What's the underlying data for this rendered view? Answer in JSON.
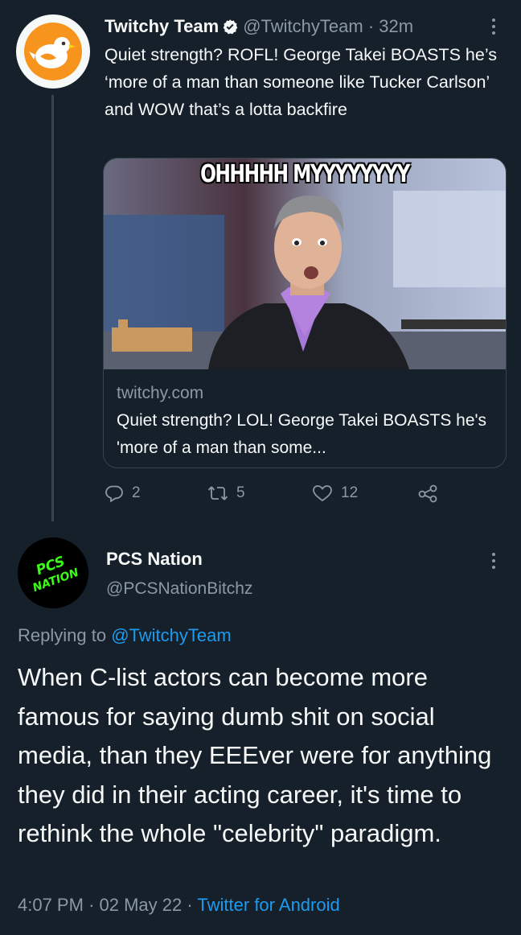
{
  "tweet1": {
    "display_name": "Twitchy Team",
    "handle": "@TwitchyTeam",
    "separator": "·",
    "time": "32m",
    "text": "Quiet strength? ROFL! George Takei BOASTS he’s ‘more of a man than someone like Tucker Carlson’ and WOW that’s a lotta backfire",
    "card": {
      "image_caption": "OHHHHH MYYYYYYYY",
      "domain": "twitchy.com",
      "title": "Quiet strength? LOL! George Takei BOASTS he's 'more of a man than some..."
    },
    "actions": {
      "replies": "2",
      "retweets": "5",
      "likes": "12"
    }
  },
  "tweet2": {
    "display_name": "PCS Nation",
    "handle": "@PCSNationBitchz",
    "avatar_text": "PCS NATION",
    "replying_prefix": "Replying to",
    "replying_to": "@TwitchyTeam",
    "text": "When C-list actors can become more famous for saying dumb shit on social media, than they EEEver were for anything they did in their acting career, it's time to rethink the whole \"celebrity\" paradigm.",
    "time": "4:07 PM",
    "date": "02 May 22",
    "separator": "·",
    "source": "Twitter for Android"
  },
  "colors": {
    "background": "#15202b",
    "text": "#f7f9f9",
    "muted": "#8b98a5",
    "link": "#1d9bf0",
    "verified_badge": "#f7f9f9",
    "avatar1_bg": "#f7941d",
    "avatar2_text": "#39ff14"
  },
  "icons": [
    "verified-icon",
    "more-icon",
    "reply-icon",
    "retweet-icon",
    "like-icon",
    "share-icon"
  ]
}
